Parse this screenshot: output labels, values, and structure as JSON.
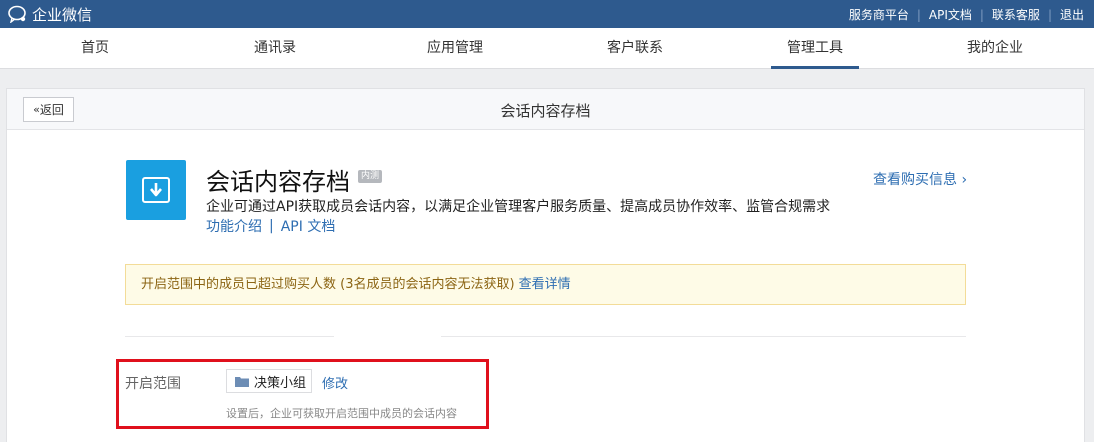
{
  "topbar": {
    "brand": "企业微信",
    "links": [
      "服务商平台",
      "API文档",
      "联系客服",
      "退出"
    ],
    "separator": "|"
  },
  "nav": {
    "tabs": [
      "首页",
      "通讯录",
      "应用管理",
      "客户联系",
      "管理工具",
      "我的企业"
    ],
    "active": "管理工具"
  },
  "panel": {
    "back_label": "返回",
    "title": "会话内容存档"
  },
  "app": {
    "icon": "download-box-icon",
    "icon_color": "#1a9fe0",
    "name": "会话内容存档",
    "tag": "内测",
    "description": "企业可通过API获取成员会话内容，以满足企业管理客户服务质量、提高成员协作效率、监管合规需求",
    "link_intro": "功能介绍",
    "link_sep": "|",
    "link_api": "API 文档",
    "buy_info": "查看购买信息"
  },
  "notice": {
    "text": "开启范围中的成员已超过购买人数 (3名成员的会话内容无法获取)",
    "link": "查看详情"
  },
  "scope": {
    "label": "开启范围",
    "group": "决策小组",
    "edit": "修改",
    "hint": "设置后，企业可获取开启范围中成员的会话内容"
  },
  "colors": {
    "topbar": "#2e5a8e",
    "link": "#2e6eb2",
    "highlight": "#e0101c"
  }
}
